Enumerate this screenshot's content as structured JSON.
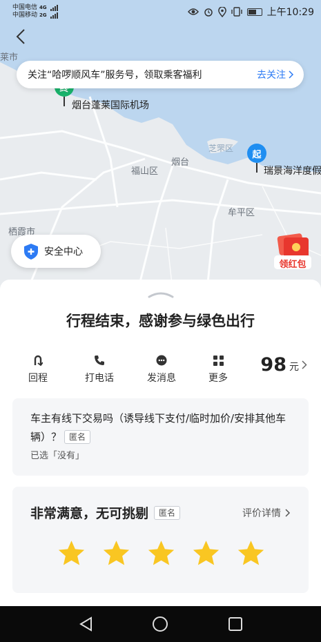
{
  "status_bar": {
    "carrier1": "中国电信",
    "carrier1_net": "4G",
    "carrier2": "中国移动",
    "carrier2_net": "2G",
    "time": "上午10:29"
  },
  "banner": {
    "text": "关注“哈啰顺风车”服务号，领取乘客福利",
    "action": "去关注"
  },
  "map": {
    "labels": {
      "airport": "烟台蓬莱国际机场",
      "fushan": "福山区",
      "yantai": "烟台",
      "zhifu": "芝罘区",
      "muping": "牟平区",
      "qixia": "栖霞市",
      "destination": "瑞景海洋度假",
      "edge": "莱市"
    },
    "start_pin": "起",
    "end_pin": "终"
  },
  "safety_center": "安全中心",
  "red_packet": "领红包",
  "sheet": {
    "title": "行程结束，感谢参与绿色出行",
    "actions": [
      {
        "label": "回程",
        "icon": "return-trip-icon"
      },
      {
        "label": "打电话",
        "icon": "phone-icon"
      },
      {
        "label": "发消息",
        "icon": "message-icon"
      },
      {
        "label": "更多",
        "icon": "grid-icon"
      }
    ],
    "price": "98",
    "price_unit": "元",
    "question": {
      "text": "车主有线下交易吗（诱导线下支付/临时加价/安排其他车辆）？",
      "tag": "匿名",
      "selected": "已选「没有」"
    },
    "rating": {
      "text": "非常满意，无可挑剔",
      "tag": "匿名",
      "detail": "评价详情",
      "stars": 5,
      "star_color": "#f9c622"
    }
  },
  "colors": {
    "accent": "#2d7bf4",
    "start_pin": "#1f8ef1",
    "end_pin": "#19b36b",
    "sea": "#bcd6ef"
  }
}
